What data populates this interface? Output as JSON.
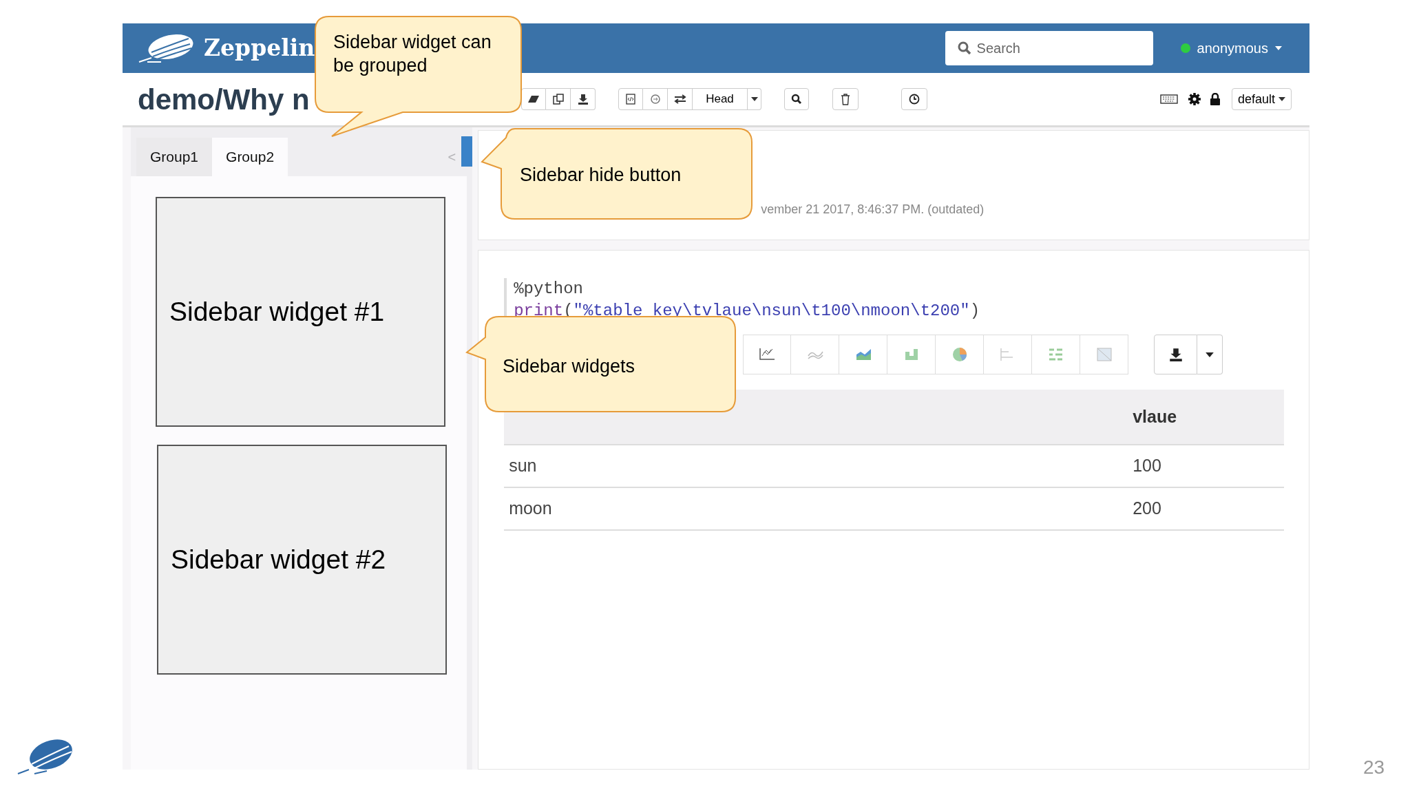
{
  "navbar": {
    "brand": "Zeppelin",
    "search": {
      "placeholder": "Search"
    },
    "user": {
      "name": "anonymous",
      "online": true
    }
  },
  "note": {
    "title": "demo/Why n",
    "mode_button": "Head",
    "interpreter_button": "default"
  },
  "sidebar": {
    "tabs": [
      {
        "label": "Group1",
        "selected": false
      },
      {
        "label": "Group2",
        "selected": true
      }
    ],
    "hide_button": "<",
    "widgets": [
      {
        "label": "Sidebar widget #1"
      },
      {
        "label": "Sidebar widget #2"
      }
    ]
  },
  "paragraphs": [
    {
      "kind": "status",
      "status_text": "vember 21 2017, 8:46:37 PM. (outdated)"
    },
    {
      "kind": "code",
      "code": [
        [
          {
            "text": "%python",
            "kind": "plain"
          }
        ],
        [
          {
            "text": "print",
            "kind": "keyword"
          },
          {
            "text": "(",
            "kind": "plain"
          },
          {
            "text": "\"%table key\\tvlaue\\nsun\\t100\\nmoon\\t200\"",
            "kind": "string"
          },
          {
            "text": ")",
            "kind": "plain"
          }
        ]
      ],
      "table": {
        "value_column": "vlaue",
        "rows": [
          {
            "key": "sun",
            "value": "100"
          },
          {
            "key": "moon",
            "value": "200"
          }
        ]
      }
    }
  ],
  "callouts": [
    {
      "text": "Sidebar widget can be grouped"
    },
    {
      "text": "Sidebar hide button"
    },
    {
      "text": "Sidebar widgets"
    }
  ],
  "slide": {
    "page_number": "23"
  }
}
